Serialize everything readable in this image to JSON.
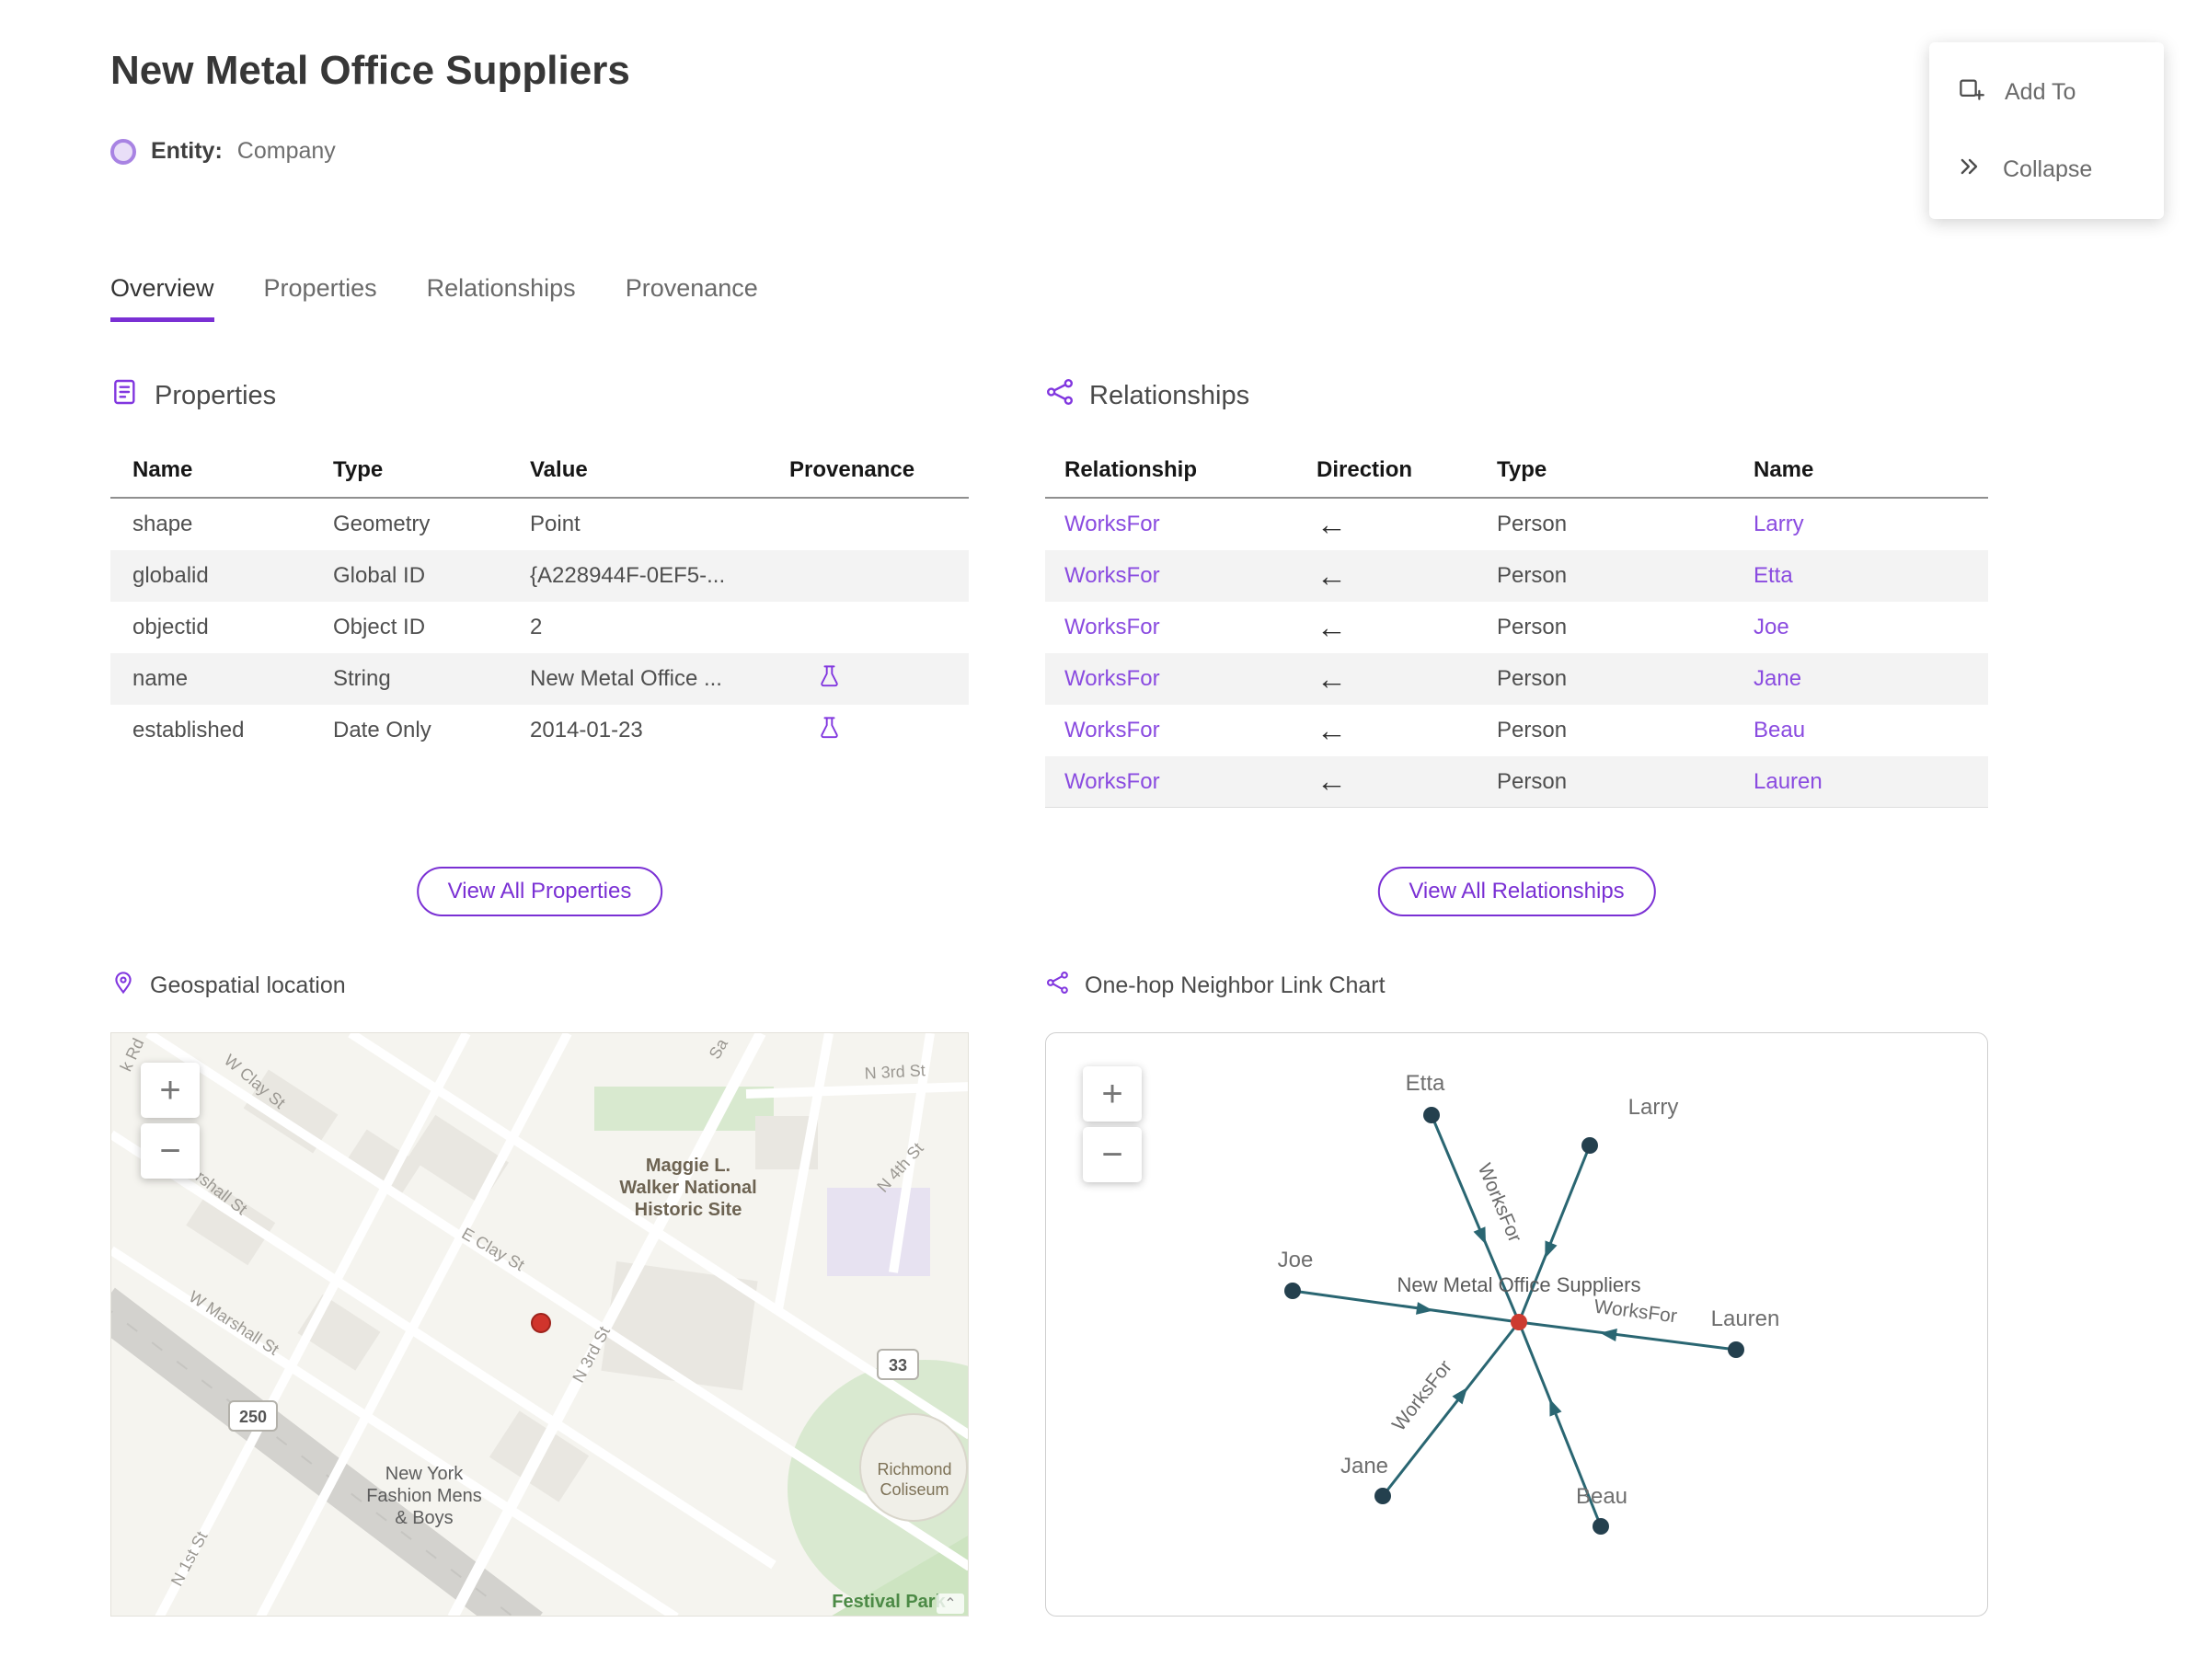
{
  "header": {
    "title": "New Metal Office Suppliers",
    "entity_label": "Entity:",
    "entity_value": "Company"
  },
  "actions": {
    "add_to": "Add To",
    "collapse": "Collapse"
  },
  "tabs": {
    "overview": "Overview",
    "properties": "Properties",
    "relationships": "Relationships",
    "provenance": "Provenance"
  },
  "properties_section": {
    "title": "Properties",
    "columns": {
      "name": "Name",
      "type": "Type",
      "value": "Value",
      "provenance": "Provenance"
    },
    "rows": [
      {
        "name": "shape",
        "type": "Geometry",
        "value": "Point"
      },
      {
        "name": "globalid",
        "type": "Global ID",
        "value": "{A228944F-0EF5-..."
      },
      {
        "name": "objectid",
        "type": "Object ID",
        "value": "2"
      },
      {
        "name": "name",
        "type": "String",
        "value": "New Metal Office ..."
      },
      {
        "name": "established",
        "type": "Date Only",
        "value": "2014-01-23"
      }
    ],
    "view_all": "View All Properties"
  },
  "relationships_section": {
    "title": "Relationships",
    "columns": {
      "relationship": "Relationship",
      "direction": "Direction",
      "type": "Type",
      "name": "Name"
    },
    "direction_arrow": "←",
    "rows": [
      {
        "relationship": "WorksFor",
        "type": "Person",
        "name": "Larry"
      },
      {
        "relationship": "WorksFor",
        "type": "Person",
        "name": "Etta"
      },
      {
        "relationship": "WorksFor",
        "type": "Person",
        "name": "Joe"
      },
      {
        "relationship": "WorksFor",
        "type": "Person",
        "name": "Jane"
      },
      {
        "relationship": "WorksFor",
        "type": "Person",
        "name": "Beau"
      },
      {
        "relationship": "WorksFor",
        "type": "Person",
        "name": "Lauren"
      }
    ],
    "view_all": "View All Relationships"
  },
  "map_section": {
    "title": "Geospatial location",
    "zoom_in": "+",
    "zoom_out": "−",
    "labels": {
      "k_rd": "k Rd",
      "sa": "Sa",
      "w_clay": "W Clay St",
      "marshall": "arshall St",
      "w_marshall": "W Marshall St",
      "e_clay": "E Clay St",
      "n3rd_top": "N 3rd St",
      "n4th": "N 4th St",
      "n3rd": "N 3rd St",
      "n1st": "N 1st St",
      "maggie_1": "Maggie L.",
      "maggie_2": "Walker National",
      "maggie_3": "Historic Site",
      "ny_1": "New York",
      "ny_2": "Fashion Mens",
      "ny_3": "& Boys",
      "coliseum_1": "Richmond",
      "coliseum_2": "Coliseum",
      "festival": "Festival Park",
      "route_250": "250",
      "route_33": "33"
    }
  },
  "link_chart_section": {
    "title": "One-hop Neighbor Link Chart",
    "zoom_in": "+",
    "zoom_out": "−",
    "center_label": "New Metal Office Suppliers",
    "edge_label": "WorksFor",
    "nodes": {
      "etta": "Etta",
      "larry": "Larry",
      "joe": "Joe",
      "lauren": "Lauren",
      "jane": "Jane",
      "beau": "Beau"
    }
  },
  "colors": {
    "accent": "#8136df",
    "link": "#8a4be0",
    "edge": "#2a6672",
    "node": "#24404e",
    "center_node": "#cc3b31",
    "stripe": "#f3f3f3"
  }
}
